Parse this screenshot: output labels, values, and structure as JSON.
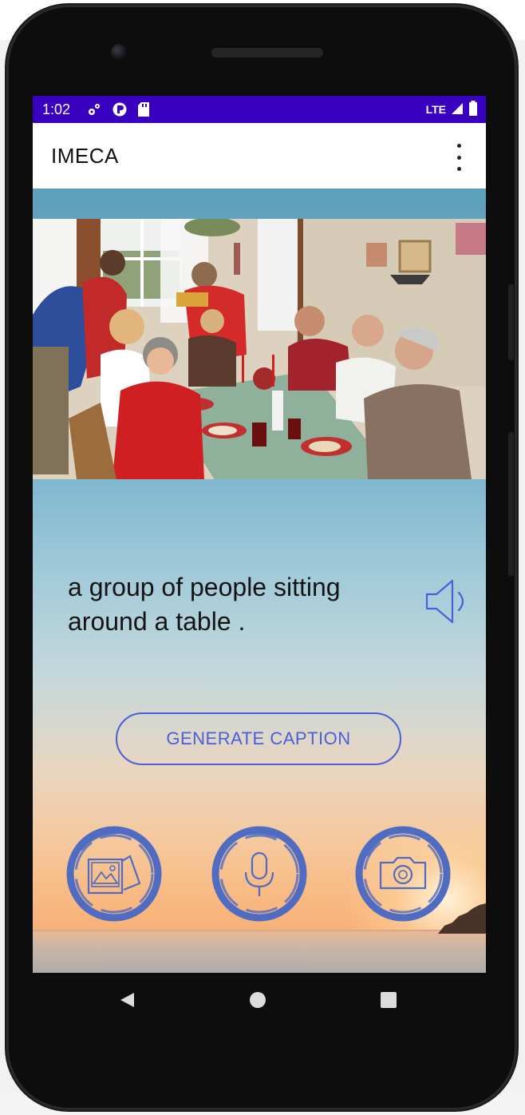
{
  "status_bar": {
    "time": "1:02",
    "network": "LTE",
    "icons": [
      "settings-icon",
      "sync-app-icon",
      "sd-card-icon",
      "signal-icon",
      "battery-icon"
    ]
  },
  "app_bar": {
    "title": "IMECA",
    "menu_icon": "overflow-menu-icon"
  },
  "main": {
    "caption": "a group of people sitting around a table .",
    "speaker_icon": "speaker-icon",
    "generate_button_label": "GENERATE CAPTION",
    "actions": [
      {
        "name": "gallery-button",
        "icon": "gallery-icon"
      },
      {
        "name": "microphone-button",
        "icon": "microphone-icon"
      },
      {
        "name": "camera-button",
        "icon": "camera-icon"
      }
    ]
  },
  "nav_bar": {
    "buttons": [
      "back-icon",
      "home-icon",
      "recents-icon"
    ]
  },
  "colors": {
    "status_bar": "#3a00c0",
    "accent": "#4a5fd8",
    "round_button_stroke": "#4f6bc2"
  }
}
